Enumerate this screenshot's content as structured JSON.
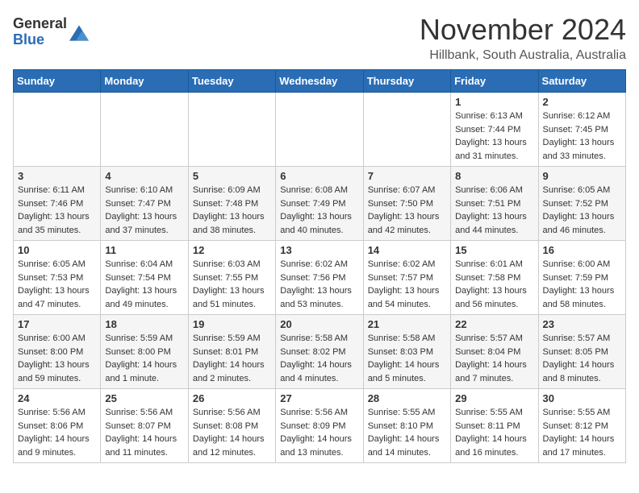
{
  "logo": {
    "general": "General",
    "blue": "Blue"
  },
  "header": {
    "month": "November 2024",
    "location": "Hillbank, South Australia, Australia"
  },
  "weekdays": [
    "Sunday",
    "Monday",
    "Tuesday",
    "Wednesday",
    "Thursday",
    "Friday",
    "Saturday"
  ],
  "weeks": [
    [
      {
        "day": "",
        "info": ""
      },
      {
        "day": "",
        "info": ""
      },
      {
        "day": "",
        "info": ""
      },
      {
        "day": "",
        "info": ""
      },
      {
        "day": "",
        "info": ""
      },
      {
        "day": "1",
        "info": "Sunrise: 6:13 AM\nSunset: 7:44 PM\nDaylight: 13 hours\nand 31 minutes."
      },
      {
        "day": "2",
        "info": "Sunrise: 6:12 AM\nSunset: 7:45 PM\nDaylight: 13 hours\nand 33 minutes."
      }
    ],
    [
      {
        "day": "3",
        "info": "Sunrise: 6:11 AM\nSunset: 7:46 PM\nDaylight: 13 hours\nand 35 minutes."
      },
      {
        "day": "4",
        "info": "Sunrise: 6:10 AM\nSunset: 7:47 PM\nDaylight: 13 hours\nand 37 minutes."
      },
      {
        "day": "5",
        "info": "Sunrise: 6:09 AM\nSunset: 7:48 PM\nDaylight: 13 hours\nand 38 minutes."
      },
      {
        "day": "6",
        "info": "Sunrise: 6:08 AM\nSunset: 7:49 PM\nDaylight: 13 hours\nand 40 minutes."
      },
      {
        "day": "7",
        "info": "Sunrise: 6:07 AM\nSunset: 7:50 PM\nDaylight: 13 hours\nand 42 minutes."
      },
      {
        "day": "8",
        "info": "Sunrise: 6:06 AM\nSunset: 7:51 PM\nDaylight: 13 hours\nand 44 minutes."
      },
      {
        "day": "9",
        "info": "Sunrise: 6:05 AM\nSunset: 7:52 PM\nDaylight: 13 hours\nand 46 minutes."
      }
    ],
    [
      {
        "day": "10",
        "info": "Sunrise: 6:05 AM\nSunset: 7:53 PM\nDaylight: 13 hours\nand 47 minutes."
      },
      {
        "day": "11",
        "info": "Sunrise: 6:04 AM\nSunset: 7:54 PM\nDaylight: 13 hours\nand 49 minutes."
      },
      {
        "day": "12",
        "info": "Sunrise: 6:03 AM\nSunset: 7:55 PM\nDaylight: 13 hours\nand 51 minutes."
      },
      {
        "day": "13",
        "info": "Sunrise: 6:02 AM\nSunset: 7:56 PM\nDaylight: 13 hours\nand 53 minutes."
      },
      {
        "day": "14",
        "info": "Sunrise: 6:02 AM\nSunset: 7:57 PM\nDaylight: 13 hours\nand 54 minutes."
      },
      {
        "day": "15",
        "info": "Sunrise: 6:01 AM\nSunset: 7:58 PM\nDaylight: 13 hours\nand 56 minutes."
      },
      {
        "day": "16",
        "info": "Sunrise: 6:00 AM\nSunset: 7:59 PM\nDaylight: 13 hours\nand 58 minutes."
      }
    ],
    [
      {
        "day": "17",
        "info": "Sunrise: 6:00 AM\nSunset: 8:00 PM\nDaylight: 13 hours\nand 59 minutes."
      },
      {
        "day": "18",
        "info": "Sunrise: 5:59 AM\nSunset: 8:00 PM\nDaylight: 14 hours\nand 1 minute."
      },
      {
        "day": "19",
        "info": "Sunrise: 5:59 AM\nSunset: 8:01 PM\nDaylight: 14 hours\nand 2 minutes."
      },
      {
        "day": "20",
        "info": "Sunrise: 5:58 AM\nSunset: 8:02 PM\nDaylight: 14 hours\nand 4 minutes."
      },
      {
        "day": "21",
        "info": "Sunrise: 5:58 AM\nSunset: 8:03 PM\nDaylight: 14 hours\nand 5 minutes."
      },
      {
        "day": "22",
        "info": "Sunrise: 5:57 AM\nSunset: 8:04 PM\nDaylight: 14 hours\nand 7 minutes."
      },
      {
        "day": "23",
        "info": "Sunrise: 5:57 AM\nSunset: 8:05 PM\nDaylight: 14 hours\nand 8 minutes."
      }
    ],
    [
      {
        "day": "24",
        "info": "Sunrise: 5:56 AM\nSunset: 8:06 PM\nDaylight: 14 hours\nand 9 minutes."
      },
      {
        "day": "25",
        "info": "Sunrise: 5:56 AM\nSunset: 8:07 PM\nDaylight: 14 hours\nand 11 minutes."
      },
      {
        "day": "26",
        "info": "Sunrise: 5:56 AM\nSunset: 8:08 PM\nDaylight: 14 hours\nand 12 minutes."
      },
      {
        "day": "27",
        "info": "Sunrise: 5:56 AM\nSunset: 8:09 PM\nDaylight: 14 hours\nand 13 minutes."
      },
      {
        "day": "28",
        "info": "Sunrise: 5:55 AM\nSunset: 8:10 PM\nDaylight: 14 hours\nand 14 minutes."
      },
      {
        "day": "29",
        "info": "Sunrise: 5:55 AM\nSunset: 8:11 PM\nDaylight: 14 hours\nand 16 minutes."
      },
      {
        "day": "30",
        "info": "Sunrise: 5:55 AM\nSunset: 8:12 PM\nDaylight: 14 hours\nand 17 minutes."
      }
    ]
  ]
}
